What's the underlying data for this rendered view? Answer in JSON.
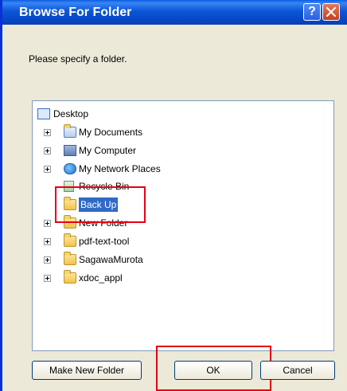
{
  "window": {
    "title": "Browse For Folder",
    "help_glyph": "?"
  },
  "prompt": "Please specify a folder.",
  "tree": {
    "items": [
      {
        "label": "Desktop",
        "icon": "desktop-icon",
        "expander": false
      },
      {
        "label": "My Documents",
        "icon": "my-documents-icon",
        "expander": true
      },
      {
        "label": "My Computer",
        "icon": "my-computer-icon",
        "expander": true
      },
      {
        "label": "My Network Places",
        "icon": "network-places-icon",
        "expander": true
      },
      {
        "label": "Recycle Bin",
        "icon": "recycle-bin-icon",
        "expander": false
      },
      {
        "label": "Back Up",
        "icon": "folder-icon",
        "expander": false,
        "selected": true
      },
      {
        "label": "New Folder",
        "icon": "folder-icon",
        "expander": true
      },
      {
        "label": "pdf-text-tool",
        "icon": "folder-icon",
        "expander": true
      },
      {
        "label": "SagawaMurota",
        "icon": "folder-icon",
        "expander": true
      },
      {
        "label": "xdoc_appl",
        "icon": "folder-icon",
        "expander": true
      }
    ]
  },
  "buttons": {
    "make_new_folder": "Make New Folder",
    "ok": "OK",
    "cancel": "Cancel"
  },
  "colors": {
    "title_bar": "#0a56d8",
    "selection": "#316ac5",
    "highlight_box": "#e60012"
  }
}
